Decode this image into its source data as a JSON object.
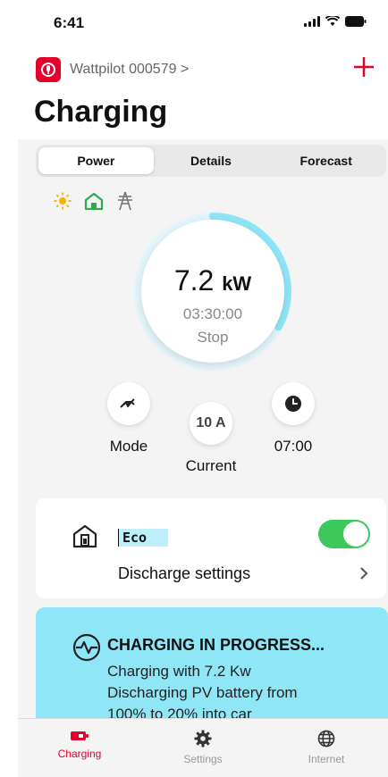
{
  "status_bar": {
    "time": "6:41"
  },
  "header": {
    "device_name": "Wattpilot 000579 >",
    "title": "Charging"
  },
  "tabs": [
    {
      "label": "Power",
      "active": true
    },
    {
      "label": "Details",
      "active": false
    },
    {
      "label": "Forecast",
      "active": false
    }
  ],
  "sources": [
    "sun-icon",
    "home-icon",
    "grid-pylon-icon"
  ],
  "gauge": {
    "power_value": "7.2",
    "power_unit": "kW",
    "duration": "03:30:00",
    "stop_label": "Stop",
    "progress": 0.33
  },
  "controls": {
    "mode_label": "Mode",
    "current_value": "10 A",
    "current_label": "Current",
    "timer_value": "07:00"
  },
  "discharge_card": {
    "eco_label": "Eco",
    "eco_enabled": true,
    "settings_label": "Discharge settings"
  },
  "progress_card": {
    "title": "CHARGING IN PROGRESS...",
    "lines": [
      "Charging with 7.2 Kw",
      "Discharging PV battery from",
      "100% to 20% into car"
    ]
  },
  "bottom_nav": [
    {
      "label": "Charging",
      "active": true
    },
    {
      "label": "Settings",
      "active": false
    },
    {
      "label": "Internet",
      "active": false
    }
  ],
  "colors": {
    "brand": "#e4002b",
    "accent": "#8fe6f7",
    "toggle_on": "#3cc85a",
    "sun": "#f5b400",
    "home": "#2fa84f"
  }
}
